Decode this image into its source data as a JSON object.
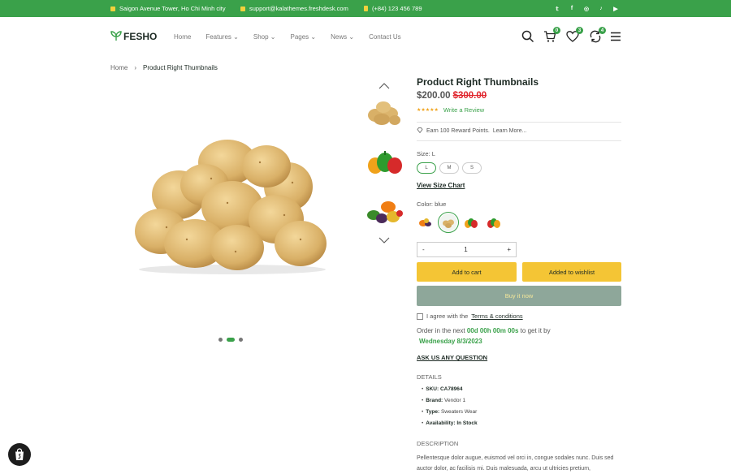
{
  "topbar": {
    "address": "Saigon Avenue Tower, Ho Chi Minh city",
    "email": "support@kalathemes.freshdesk.com",
    "phone": "(+84) 123 456 789",
    "social": [
      "twitter-icon",
      "facebook-icon",
      "instagram-icon",
      "tiktok-icon",
      "youtube-icon"
    ]
  },
  "header": {
    "logo": "FESHO",
    "nav": [
      "Home",
      "Features",
      "Shop",
      "Pages",
      "News",
      "Contact Us"
    ],
    "cart_count": "0",
    "wishlist_count": "3",
    "compare_count": "4"
  },
  "breadcrumb": {
    "home": "Home",
    "current": "Product Right Thumbnails"
  },
  "product": {
    "title": "Product Right Thumbnails",
    "price": "$200.00",
    "old_price": "$300.00",
    "rating": 5,
    "stars": "★★★★★",
    "review_link": "Write a Review",
    "reward": "Earn 100 Reward Points.",
    "learn_more": "Learn More...",
    "size_label": "Size: L",
    "sizes": [
      "L",
      "M",
      "S"
    ],
    "size_chart": "View Size Chart",
    "color_label": "Color: blue",
    "quantity": "1",
    "minus": "-",
    "plus": "+",
    "add_to_cart": "Add to cart",
    "add_to_wishlist": "Added to wishlist",
    "buy_now": "Buy it now",
    "agree_prefix": "I agree with the",
    "terms": "Terms & conditions",
    "order_prefix": "Order in the next",
    "countdown": "00d 00h 00m 00s",
    "order_suffix": "to get it by",
    "delivery_date": "Wednesday 8/3/2023",
    "ask": "ASK US ANY QUESTION",
    "details_heading": "DETAILS",
    "details": [
      {
        "label": "SKU:",
        "value": "CA78964"
      },
      {
        "label": "Brand:",
        "value": "Vendor 1"
      },
      {
        "label": "Type:",
        "value": "Sweaters Wear"
      },
      {
        "label": "Availability:",
        "value": "In Stock"
      }
    ],
    "description_heading": "DESCRIPTION",
    "description": "Pellentesque dolor augue, euismod vel orci in, congue sodales nunc. Duis sed auctor dolor, ac facilisis mi. Duis malesuada, arcu ut ultricies pretium,"
  },
  "colors": {
    "brand_green": "#3aa14a",
    "yellow": "#f4c535",
    "buy_now_bg": "#8ea79a",
    "sale_red": "#e0242c"
  }
}
